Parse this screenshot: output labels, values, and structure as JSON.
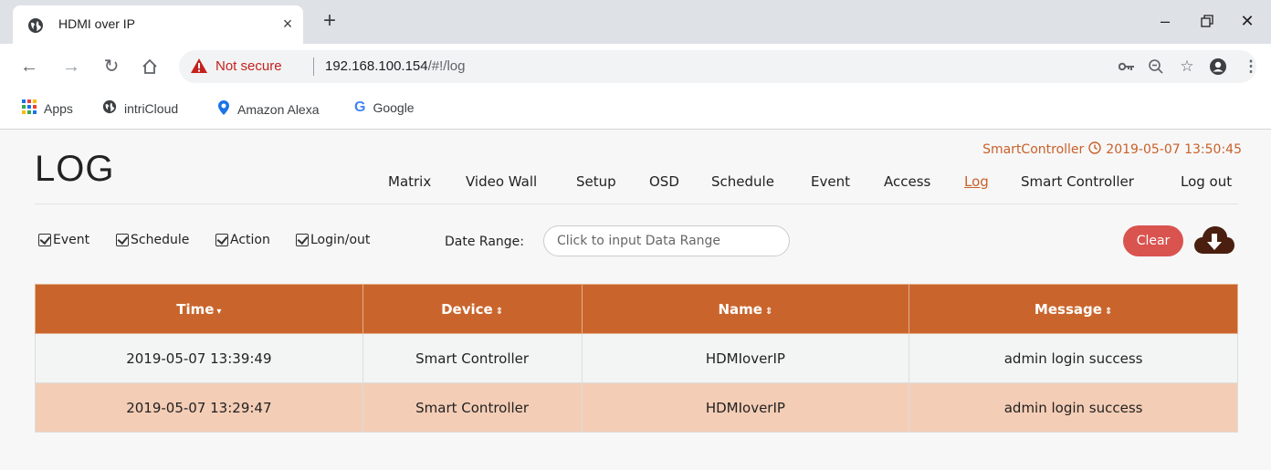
{
  "browser": {
    "tab_title": "HDMI over IP",
    "tab_close": "×",
    "new_tab": "+",
    "security_label": "Not secure",
    "url_host": "192.168.100.154",
    "url_path": "/#!/log",
    "bookmarks": [
      "Apps",
      "intriCloud",
      "Amazon Alexa",
      "Google"
    ]
  },
  "header": {
    "logo": "LOG",
    "status_user": "SmartController",
    "status_time": "2019-05-07 13:50:45",
    "nav": [
      {
        "label": "Matrix"
      },
      {
        "label": "Video Wall"
      },
      {
        "label": "Setup"
      },
      {
        "label": "OSD"
      },
      {
        "label": "Schedule"
      },
      {
        "label": "Event"
      },
      {
        "label": "Access"
      },
      {
        "label": "Log",
        "active": true
      },
      {
        "label": "Smart Controller"
      },
      {
        "label": "Log out"
      }
    ]
  },
  "filters": {
    "checkboxes": [
      {
        "label": "Event",
        "checked": true
      },
      {
        "label": "Schedule",
        "checked": true
      },
      {
        "label": "Action",
        "checked": true
      },
      {
        "label": "Login/out",
        "checked": true
      }
    ],
    "date_range_label": "Date Range:",
    "date_range_placeholder": "Click to input Data Range",
    "clear_label": "Clear"
  },
  "table": {
    "columns": [
      "Time",
      "Device",
      "Name",
      "Message"
    ],
    "rows": [
      [
        "2019-05-07 13:39:49",
        "Smart Controller",
        "HDMIoverIP",
        "admin login success"
      ],
      [
        "2019-05-07 13:29:47",
        "Smart Controller",
        "HDMIoverIP",
        "admin login success"
      ]
    ]
  },
  "colors": {
    "accent": "#c9652c",
    "clear_button": "#d9534f",
    "highlight_row": "#f4cdb6"
  }
}
